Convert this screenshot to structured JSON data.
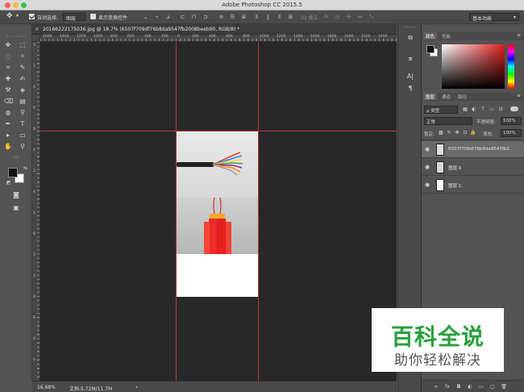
{
  "app": {
    "window_title": "Adobe Photoshop CC 2015.5"
  },
  "options_bar": {
    "auto_select_label": "自动选择:",
    "auto_select_value": "图层",
    "show_transform_label": "显示变换控件",
    "mode_3d_label": "3D 模式:",
    "workspace_value": "基本功能"
  },
  "document": {
    "tab_title": "20166222175036.jpg @ 18.7% (6507f709df76b8da9547fb2008beeb90, RGB/8) *",
    "zoom": "16.68%",
    "doc_size": "文档:5.72M/11.7M",
    "nav_arrow": "›"
  },
  "ruler": {
    "top_numbers": [
      "1600",
      "1400",
      "1200",
      "1000",
      "800",
      "600",
      "400",
      "200",
      "0",
      "200",
      "400",
      "600",
      "800",
      "1000",
      "1200",
      "1400",
      "1600",
      "1800",
      "2000",
      "2200",
      "2400"
    ],
    "left_numbers": [
      "0",
      "2",
      "4",
      "6",
      "8",
      "0",
      "2",
      "4",
      "6",
      "8",
      "0",
      "2",
      "4",
      "6",
      "8",
      "0"
    ]
  },
  "panels": {
    "color_tabs": [
      "颜色",
      "色板"
    ],
    "layer_tabs": [
      "图层",
      "通道",
      "路径"
    ],
    "filter_kind": "ρ 类型",
    "blend_mode": "正常",
    "opacity_label": "不透明度:",
    "opacity_value": "100%",
    "lock_label": "锁定:",
    "fill_label": "填充:",
    "fill_value": "100%",
    "layers": [
      {
        "name": "6507f709df76b8da9547fb2..."
      },
      {
        "name": "图层 0"
      },
      {
        "name": "图层 1"
      }
    ],
    "bottom_buttons": [
      "∞",
      "fx",
      "◘",
      "◐",
      "▭",
      "▢",
      "🗑"
    ]
  },
  "toolbox": {
    "tools": [
      "✥",
      "⬚",
      "◌",
      "✧",
      "⌗",
      "✎",
      "✚",
      "✍",
      "⚒",
      "◈",
      "⌫",
      "▤",
      "◍",
      "⚲",
      "✒",
      "T",
      "▸",
      "▭",
      "✋",
      "⚲"
    ],
    "more": "···"
  },
  "watermark": {
    "line1": "百科全说",
    "line2": "助你轻松解决"
  },
  "colors": {
    "guide": "#b53838",
    "watermark_green": "#27a03c"
  }
}
